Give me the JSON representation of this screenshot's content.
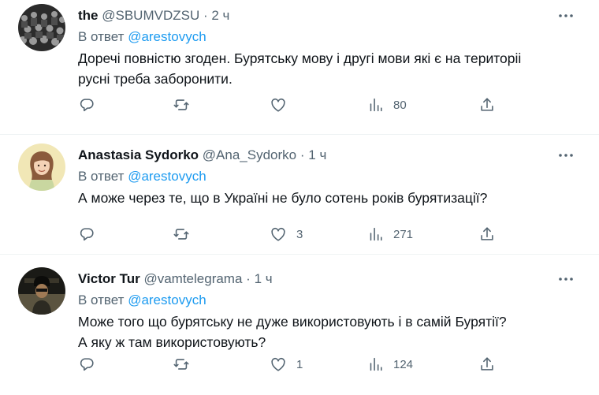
{
  "reply_prefix": "В ответ",
  "colors": {
    "link": "#1d9bf0",
    "secondary": "#536471",
    "text": "#0f1419",
    "divider": "#eff3f4"
  },
  "icons": [
    "reply-icon",
    "retweet-icon",
    "like-icon",
    "views-icon",
    "share-icon",
    "more-icon"
  ],
  "tweets": [
    {
      "name": "the",
      "handle": "@SBUMVDZSU",
      "separator": "·",
      "time": "2 ч",
      "reply_to": "@arestovych",
      "lines": [
        "Доречі  повністю згоден. Бурятську  мову  і другі мови які є на територіі",
        "русні треба  заборонити."
      ],
      "likes": "",
      "views": "80"
    },
    {
      "name": "Anastasia Sydorko",
      "handle": "@Ana_Sydorko",
      "separator": "·",
      "time": "1 ч",
      "reply_to": "@arestovych",
      "lines": [
        "А може через те, що в Україні не було сотень років бурятизації?"
      ],
      "likes": "3",
      "views": "271"
    },
    {
      "name": "Victor Tur",
      "handle": "@vamtelegrama",
      "separator": "·",
      "time": "1 ч",
      "reply_to": "@arestovych",
      "lines": [
        "Може того що бурятську не дуже використовують і в самій Бурятії?",
        "А яку ж там використовують?"
      ],
      "likes": "1",
      "views": "124"
    }
  ]
}
